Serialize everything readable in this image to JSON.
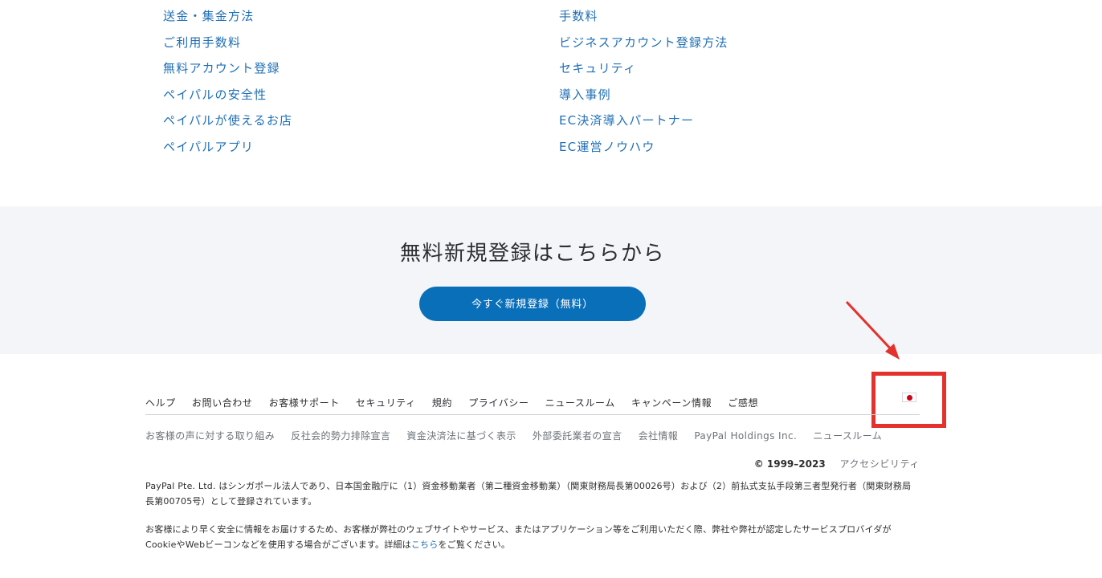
{
  "links": {
    "left": [
      "送金・集金方法",
      "ご利用手数料",
      "無料アカウント登録",
      "ペイパルの安全性",
      "ペイパルが使えるお店",
      "ペイパルアプリ"
    ],
    "right": [
      "手数料",
      "ビジネスアカウント登録方法",
      "セキュリティ",
      "導入事例",
      "EC決済導入パートナー",
      "EC運営ノウハウ"
    ]
  },
  "signup": {
    "title": "無料新規登録はこちらから",
    "button": "今すぐ新規登録（無料）"
  },
  "footer": {
    "nav": [
      "ヘルプ",
      "お問い合わせ",
      "お客様サポート",
      "セキュリティ",
      "規約",
      "プライバシー",
      "ニュースルーム",
      "キャンペーン情報",
      "ご感想"
    ],
    "legal": [
      "お客様の声に対する取り組み",
      "反社会的勢力排除宣言",
      "資金決済法に基づく表示",
      "外部委託業者の宣言",
      "会社情報",
      "PayPal Holdings Inc.",
      "ニュースルーム"
    ],
    "copyright": "© 1999–2023",
    "accessibility": "アクセシビリティ",
    "para1": "PayPal Pte. Ltd. はシンガポール法人であり、日本国金融庁に（1）資金移動業者（第二種資金移動業）（関東財務局長第00026号）および（2）前払式支払手段第三者型発行者（関東財務局長第00705号）として登録されています。",
    "para2_before": "お客様により早く安全に情報をお届けするため、お客様が弊社のウェブサイトやサービス、またはアプリケーション等をご利用いただく際、弊社や弊社が認定したサービスプロバイダがCookieやWebビーコンなどを使用する場合がございます。詳細は",
    "para2_link": "こちら",
    "para2_after": "をご覧ください。",
    "flag_icon": "japan-flag-icon"
  },
  "colors": {
    "link": "#1f6fb6",
    "button": "#0a6fb9",
    "band": "#f4f5f8",
    "annotation": "#e3312d"
  }
}
